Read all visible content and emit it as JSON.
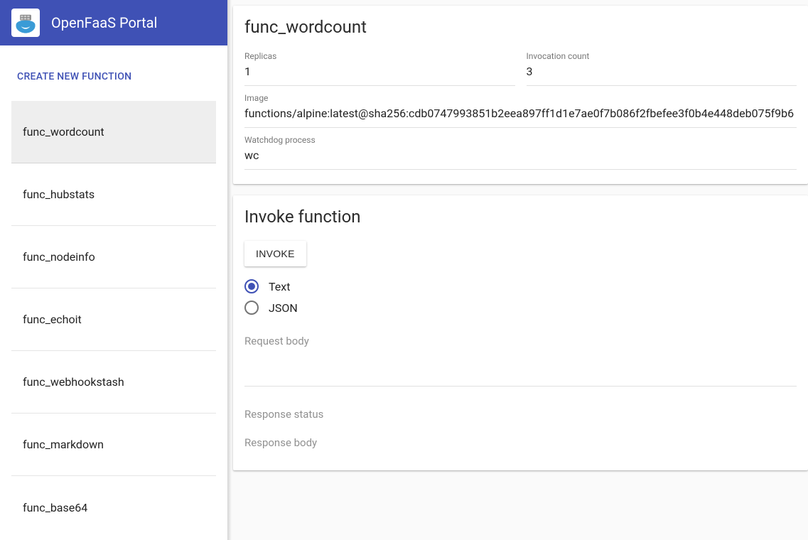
{
  "header": {
    "title": "OpenFaaS Portal"
  },
  "sidebar": {
    "create_label": "Create New Function",
    "selected_index": 0,
    "items": [
      {
        "name": "func_wordcount"
      },
      {
        "name": "func_hubstats"
      },
      {
        "name": "func_nodeinfo"
      },
      {
        "name": "func_echoit"
      },
      {
        "name": "func_webhookstash"
      },
      {
        "name": "func_markdown"
      },
      {
        "name": "func_base64"
      }
    ]
  },
  "detail": {
    "title": "func_wordcount",
    "labels": {
      "replicas": "Replicas",
      "invocation_count": "Invocation count",
      "image": "Image",
      "watchdog": "Watchdog process"
    },
    "replicas": "1",
    "invocation_count": "3",
    "image": "functions/alpine:latest@sha256:cdb0747993851b2eea897ff1d1e7ae0f7b086f2fbefee3f0b4e448deb075f9b6",
    "watchdog": "wc"
  },
  "invoke": {
    "title": "Invoke function",
    "button_label": "Invoke",
    "request_type_selected": "text",
    "options": {
      "text": "Text",
      "json": "JSON"
    },
    "labels": {
      "request_body": "Request body",
      "response_status": "Response status",
      "response_body": "Response body"
    }
  }
}
